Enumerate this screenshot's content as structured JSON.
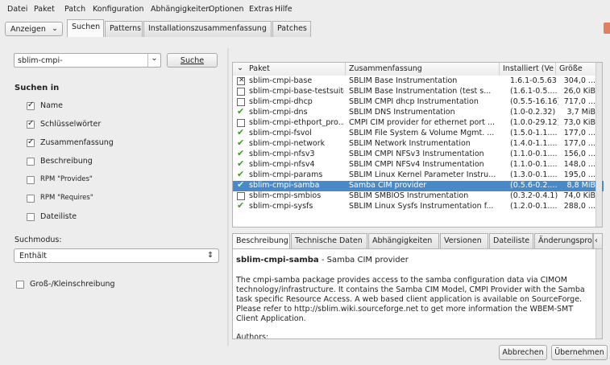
{
  "menu": {
    "items": [
      "Datei",
      "Paket",
      "Patch",
      "Konfiguration",
      "Abhängigkeiten",
      "Optionen",
      "Extras",
      "Hilfe"
    ]
  },
  "toolbar": {
    "view_label": "Anzeigen",
    "tabs": [
      "Suchen",
      "Patterns",
      "Installationszusammenfassung",
      "Patches"
    ]
  },
  "search": {
    "value": "sblim-cmpi-",
    "button": "Suche",
    "section_title": "Suchen in",
    "options": [
      {
        "label": "Name",
        "checked": true
      },
      {
        "label": "Schlüsselwörter",
        "checked": true
      },
      {
        "label": "Zusammenfassung",
        "checked": true
      },
      {
        "label": "Beschreibung",
        "checked": false
      },
      {
        "label": "RPM \"Provides\"",
        "checked": false
      },
      {
        "label": "RPM \"Requires\"",
        "checked": false
      },
      {
        "label": "Dateiliste",
        "checked": false
      }
    ],
    "mode_label": "Suchmodus:",
    "mode_value": "Enthält",
    "case_label": "Groß-/Kleinschreibung"
  },
  "table": {
    "columns": [
      "Paket",
      "Zusammenfassung",
      "Installiert (Ve",
      "Größe"
    ],
    "rows": [
      {
        "status": "boxx",
        "name": "sblim-cmpi-base",
        "summary": "SBLIM Base Instrumentation",
        "installed": "1.6.1-0.5.63",
        "size": "304,0 ..."
      },
      {
        "status": "box",
        "name": "sblim-cmpi-base-testsuite",
        "summary": "SBLIM Base Instrumentation (test s...",
        "installed": "(1.6.1-0.5....",
        "size": "26,0 KiB"
      },
      {
        "status": "box",
        "name": "sblim-cmpi-dhcp",
        "summary": "SBLIM CMPI dhcp Instrumentation",
        "installed": "(0.5.5-16.16)",
        "size": "717,0 ..."
      },
      {
        "status": "chk",
        "name": "sblim-cmpi-dns",
        "summary": "SBLIM DNS Instrumentation",
        "installed": "(1.0-0.2.32)",
        "size": "3,7 MiB"
      },
      {
        "status": "box",
        "name": "sblim-cmpi-ethport_pro...",
        "summary": "CMPI CIM provider for ethernet port ...",
        "installed": "(1.0.0-29.12)",
        "size": "73,0 KiB"
      },
      {
        "status": "chk",
        "name": "sblim-cmpi-fsvol",
        "summary": "SBLIM File System & Volume Mgmt. ...",
        "installed": "(1.5.0-1.1....",
        "size": "177,0 ..."
      },
      {
        "status": "chk",
        "name": "sblim-cmpi-network",
        "summary": "SBLIM Network Instrumentation",
        "installed": "(1.4.0-1.1....",
        "size": "177,0 ..."
      },
      {
        "status": "chk",
        "name": "sblim-cmpi-nfsv3",
        "summary": "SBLIM CMPI NFSv3 Instrumentation",
        "installed": "(1.1.0-0.1....",
        "size": "156,0 ..."
      },
      {
        "status": "chk",
        "name": "sblim-cmpi-nfsv4",
        "summary": "SBLIM CMPI NFSv4 Instrumentation",
        "installed": "(1.1.0-0.1....",
        "size": "148,0 ..."
      },
      {
        "status": "chk",
        "name": "sblim-cmpi-params",
        "summary": "SBLIM Linux Kernel Parameter Instru...",
        "installed": "(1.3.0-0.1....",
        "size": "195,0 ..."
      },
      {
        "status": "chk",
        "name": "sblim-cmpi-samba",
        "summary": "Samba CIM provider",
        "installed": "(0.5.6-0.2....",
        "size": "8,8 MiB",
        "selected": true
      },
      {
        "status": "box",
        "name": "sblim-cmpi-smbios",
        "summary": "SBLIM SMBIOS Instrumentation",
        "installed": "(0.3.2-0.4.1)",
        "size": "74,0 KiB"
      },
      {
        "status": "chk",
        "name": "sblim-cmpi-sysfs",
        "summary": "SBLIM Linux Sysfs Instrumentation f...",
        "installed": "(1.2.0-0.1....",
        "size": "288,0 ..."
      }
    ]
  },
  "detail": {
    "tabs": [
      "Beschreibung",
      "Technische Daten",
      "Abhängigkeiten",
      "Versionen",
      "Dateiliste",
      "Änderungsprot"
    ],
    "pkg_name": "sblim-cmpi-samba",
    "pkg_summary": " - Samba CIM provider",
    "body": "The cmpi-samba package provides access to the samba configuration data via CIMOM technology/infrastructure. It contains the Samba CIM Model, CMPI Provider with the Samba task specific Resource Access. A web based client application is available on SourceForge. Please refer to http://sblim.wiki.sourceforge.net to get more information the WBEM-SMT Client Application.",
    "authors": "Authors:"
  },
  "footer": {
    "cancel": "Abbrechen",
    "apply": "Übernehmen"
  }
}
